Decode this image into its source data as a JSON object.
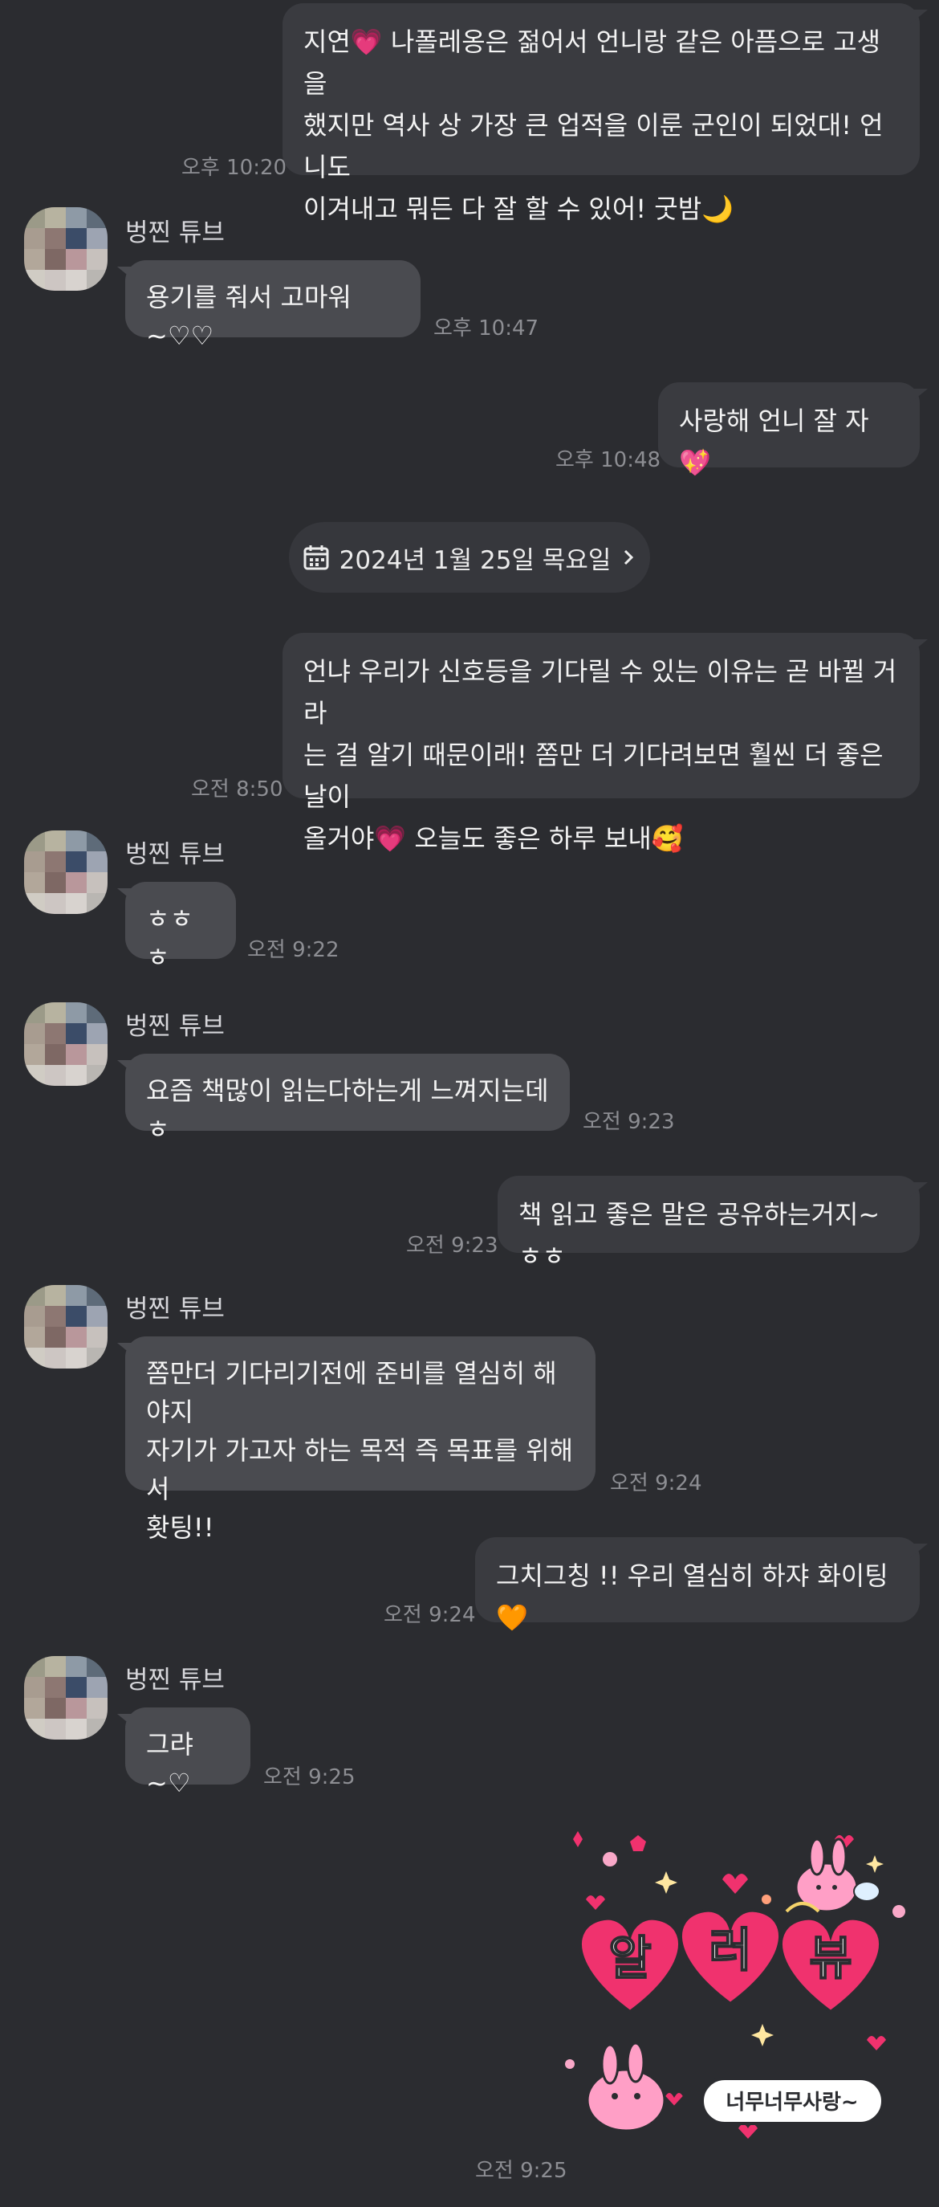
{
  "contact": {
    "name": "벙찐 튜브"
  },
  "date_divider": {
    "label": "2024년 1월 25일 목요일",
    "icon": "calendar-icon",
    "chevron": "chevron-right-icon"
  },
  "messages": [
    {
      "sender": "me",
      "text": "지연💗 나폴레옹은 젊어서 언니랑 같은 아픔으로 고생을\n했지만 역사 상 가장 큰 업적을 이룬 군인이 되었대! 언니도\n이겨내고 뭐든 다 잘 할 수 있어! 굿밤🌙",
      "time": "오후 10:20"
    },
    {
      "sender": "other",
      "text": "용기를 줘서 고마워~♡♡",
      "time": "오후 10:47"
    },
    {
      "sender": "me",
      "text": "사랑해 언니 잘 자💖",
      "time": "오후 10:48"
    },
    {
      "sender": "me",
      "text": "언냐 우리가 신호등을 기다릴 수 있는 이유는 곧 바뀔 거라\n는 걸 알기 때문이래! 쫌만 더 기다려보면 훨씬 더 좋은 날이\n올거야💗 오늘도 좋은 하루 보내🥰",
      "time": "오전 8:50"
    },
    {
      "sender": "other",
      "text": "ㅎㅎㅎ",
      "time": "오전 9:22"
    },
    {
      "sender": "other",
      "text": "요즘 책많이 읽는다하는게 느껴지는데ㅎ",
      "time": "오전 9:23"
    },
    {
      "sender": "me",
      "text": "책 읽고 좋은 말은 공유하는거지~ㅎㅎ",
      "time": "오전 9:23"
    },
    {
      "sender": "other",
      "text": "쫌만더 기다리기전에 준비를 열심히 해야지\n자기가 가고자 하는 목적 즉 목표를 위해서\n홧팅!!",
      "time": "오전 9:24"
    },
    {
      "sender": "me",
      "text": "그치그칭 !! 우리 열심히 하쟈 화이팅🧡",
      "time": "오전 9:24"
    },
    {
      "sender": "other",
      "text": "그랴~♡",
      "time": "오전 9:25"
    }
  ],
  "sticker": {
    "big_text": [
      "알",
      "러",
      "뷰"
    ],
    "caption": "너무너무사랑~",
    "time": "오전 9:25"
  },
  "colors": {
    "background": "#2b2c30",
    "my_bubble": "#3a3b40",
    "other_bubble": "#4a4b50",
    "sticker_heart": "#f0326e",
    "sticker_pink": "#ff9fc6"
  }
}
